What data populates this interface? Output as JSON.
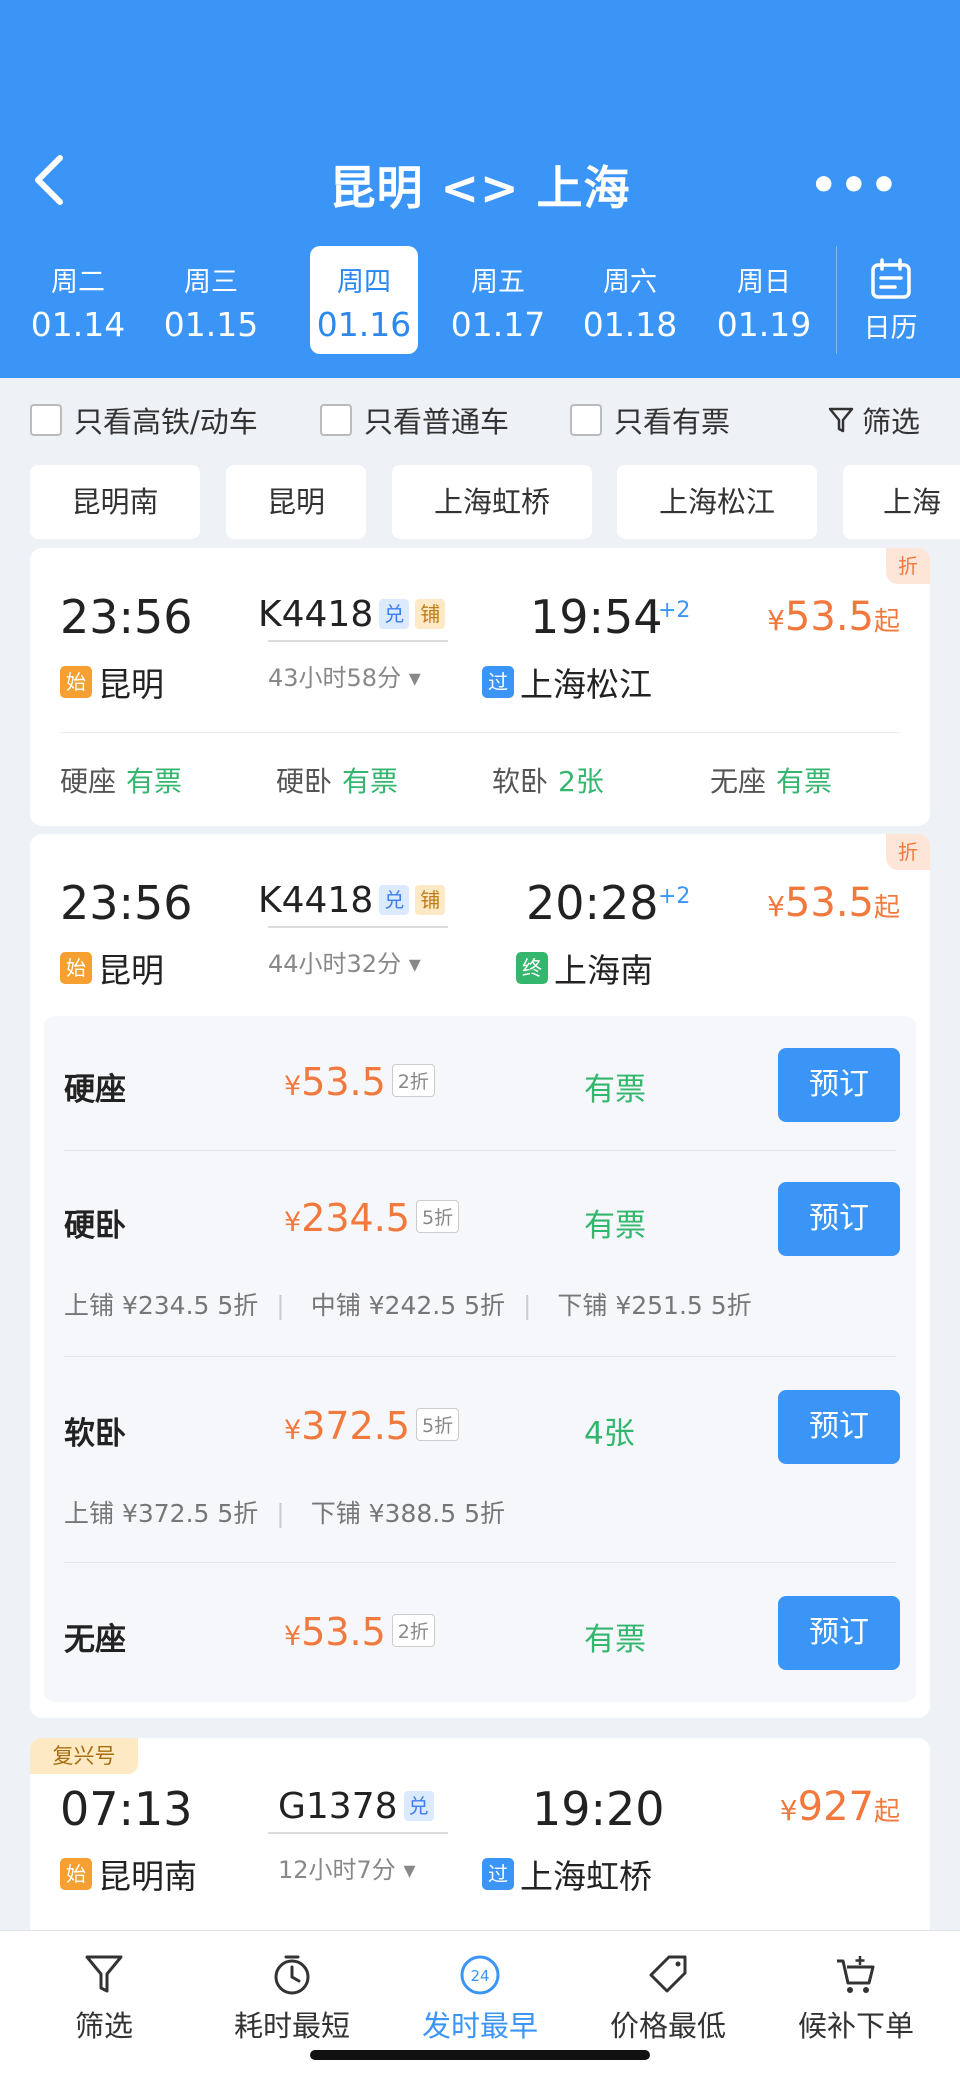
{
  "header": {
    "title": "昆明 <> 上海",
    "back_icon": "chevron-left-icon",
    "more": "•••",
    "calendar_label": "日历"
  },
  "dates": [
    {
      "week": "周二",
      "date": "01.14"
    },
    {
      "week": "周三",
      "date": "01.15"
    },
    {
      "week": "周四",
      "date": "01.16"
    },
    {
      "week": "周五",
      "date": "01.17"
    },
    {
      "week": "周六",
      "date": "01.18"
    },
    {
      "week": "周日",
      "date": "01.19"
    }
  ],
  "filters": {
    "gaotie": "只看高铁/动车",
    "putong": "只看普通车",
    "youpiao": "只看有票",
    "shaixuan": "筛选"
  },
  "stations": [
    "昆明南",
    "昆明",
    "上海虹桥",
    "上海松江",
    "上海"
  ],
  "trains": [
    {
      "depart": "23:56",
      "no": "K4418",
      "tag1": "兑",
      "tag2": "铺",
      "arrive": "19:54",
      "plus": "+2",
      "price": "53.5",
      "yen": "¥",
      "qi": "起",
      "duration": "43小时58分",
      "from_badge": "始",
      "from": "昆明",
      "to_badge": "过",
      "to": "上海松江",
      "zhe": "折",
      "seats": [
        {
          "name": "硬座",
          "status": "有票"
        },
        {
          "name": "硬卧",
          "status": "有票"
        },
        {
          "name": "软卧",
          "status": "2张"
        },
        {
          "name": "无座",
          "status": "有票"
        }
      ]
    },
    {
      "depart": "23:56",
      "no": "K4418",
      "tag1": "兑",
      "tag2": "铺",
      "arrive": "20:28",
      "plus": "+2",
      "price": "53.5",
      "yen": "¥",
      "qi": "起",
      "duration": "44小时32分",
      "from_badge": "始",
      "from": "昆明",
      "to_badge": "终",
      "to": "上海南",
      "zhe": "折",
      "detail": [
        {
          "name": "硬座",
          "price": "53.5",
          "disc": "2折",
          "status": "有票",
          "book": "预订"
        },
        {
          "name": "硬卧",
          "price": "234.5",
          "disc": "5折",
          "status": "有票",
          "book": "预订",
          "berths": [
            {
              "label": "上铺 ¥234.5",
              "disc": "5折"
            },
            {
              "label": "中铺 ¥242.5",
              "disc": "5折"
            },
            {
              "label": "下铺 ¥251.5",
              "disc": "5折"
            }
          ]
        },
        {
          "name": "软卧",
          "price": "372.5",
          "disc": "5折",
          "status": "4张",
          "book": "预订",
          "berths": [
            {
              "label": "上铺 ¥372.5",
              "disc": "5折"
            },
            {
              "label": "下铺 ¥388.5",
              "disc": "5折"
            }
          ]
        },
        {
          "name": "无座",
          "price": "53.5",
          "disc": "2折",
          "status": "有票",
          "book": "预订"
        }
      ]
    },
    {
      "badge": "复兴号",
      "depart": "07:13",
      "no": "G1378",
      "tag1": "兑",
      "arrive": "19:20",
      "price": "927",
      "yen": "¥",
      "qi": "起",
      "duration": "12小时7分",
      "from_badge": "始",
      "from": "昆明南",
      "to_badge": "过",
      "to": "上海虹桥"
    }
  ],
  "bottom": {
    "items": [
      {
        "label": "筛选",
        "icon": "filter-icon"
      },
      {
        "label": "耗时最短",
        "icon": "timer-icon"
      },
      {
        "label": "发时最早",
        "icon": "clock-24-icon",
        "badge": "24"
      },
      {
        "label": "价格最低",
        "icon": "price-tag-icon"
      },
      {
        "label": "候补下单",
        "icon": "cart-add-icon"
      }
    ]
  },
  "colors": {
    "brand_blue": "#3a95f7",
    "price_orange": "#f2793d",
    "available_green": "#35b66f"
  }
}
